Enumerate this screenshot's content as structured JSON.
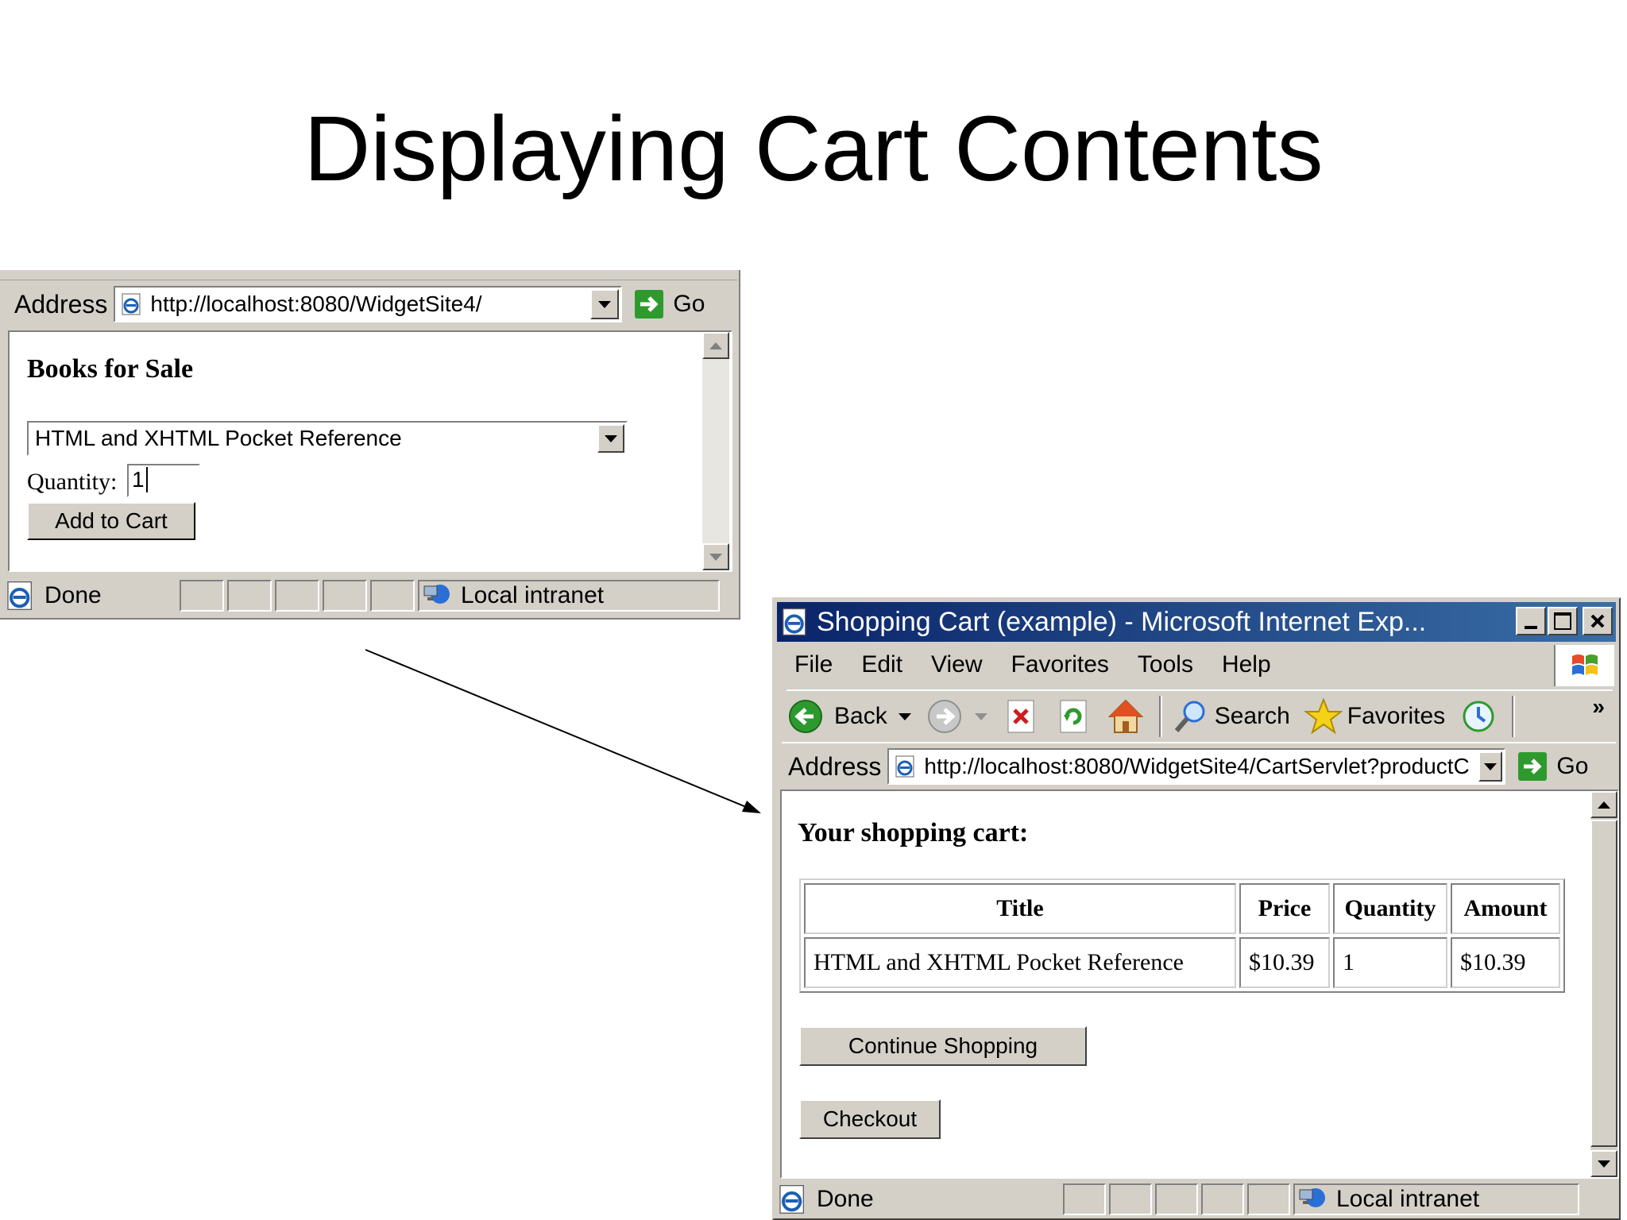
{
  "slide": {
    "title": "Displaying Cart Contents"
  },
  "window1": {
    "address_label": "Address",
    "url": "http://localhost:8080/WidgetSite4/",
    "go_label": "Go",
    "heading": "Books for Sale",
    "select_value": "HTML and XHTML Pocket Reference",
    "quantity_label": "Quantity:",
    "quantity_value": "1",
    "add_button": "Add to Cart",
    "status_text": "Done",
    "zone_text": "Local intranet"
  },
  "window2": {
    "title": "Shopping Cart (example) - Microsoft Internet Exp...",
    "menu": [
      "File",
      "Edit",
      "View",
      "Favorites",
      "Tools",
      "Help"
    ],
    "toolbar": {
      "back": "Back",
      "search": "Search",
      "favorites": "Favorites",
      "chevron": "»"
    },
    "address_label": "Address",
    "url": "http://localhost:8080/WidgetSite4/CartServlet?productC",
    "go_label": "Go",
    "heading": "Your shopping cart:",
    "table": {
      "headers": [
        "Title",
        "Price",
        "Quantity",
        "Amount"
      ],
      "rows": [
        [
          "HTML and XHTML Pocket Reference",
          "$10.39",
          "1",
          "$10.39"
        ]
      ]
    },
    "continue_button": "Continue Shopping",
    "checkout_button": "Checkout",
    "status_text": "Done",
    "zone_text": "Local intranet"
  },
  "colors": {
    "titlebar": "#0a246a",
    "chrome": "#d4d0c8"
  }
}
